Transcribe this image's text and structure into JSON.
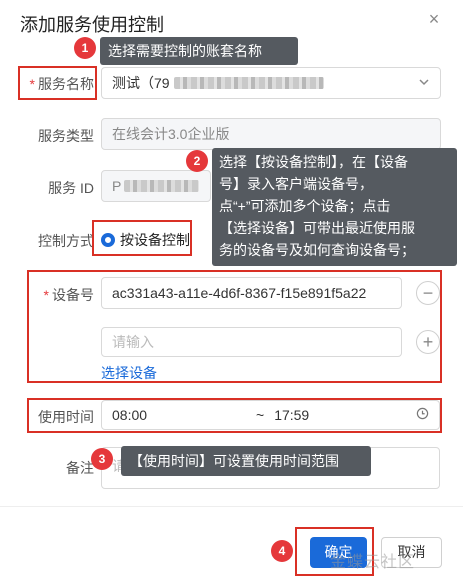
{
  "dialog": {
    "title": "添加服务使用控制",
    "close_icon": "×"
  },
  "form": {
    "service_name": {
      "label": "服务名称",
      "value": "测试（79"
    },
    "service_type": {
      "label": "服务类型",
      "value": "在线会计3.0企业版"
    },
    "service_id": {
      "label": "服务 ID",
      "value": "P"
    },
    "control_mode": {
      "label": "控制方式",
      "option": "按设备控制"
    },
    "device_no": {
      "label": "设备号",
      "value": "ac331a43-a11e-4d6f-8367-f15e891f5a22",
      "placeholder": "请输入",
      "select_link": "选择设备",
      "remove_icon": "−",
      "add_icon": "+"
    },
    "use_time": {
      "label": "使用时间",
      "start": "08:00",
      "separator": "~",
      "end": "17:59"
    },
    "remark": {
      "label": "备注",
      "placeholder": "请输入"
    }
  },
  "footer": {
    "ok_label": "确定",
    "cancel_label": "取消"
  },
  "annotations": [
    {
      "num": "1",
      "text": "选择需要控制的账套名称"
    },
    {
      "num": "2",
      "lines": [
        "选择【按设备控制】，在【设备",
        "号】录入客户端设备号，",
        "点“+”可添加多个设备；点击",
        "【选择设备】可带出最近使用服",
        "务的设备号及如何查询设备号；"
      ]
    },
    {
      "num": "3",
      "text": "【使用时间】可设置使用时间范围"
    },
    {
      "num": "4"
    }
  ],
  "watermark": "金蝶云社区",
  "colors": {
    "accent": "#1a6ad9",
    "annotation_red": "#d93025",
    "callout_bg": "#555a60"
  }
}
